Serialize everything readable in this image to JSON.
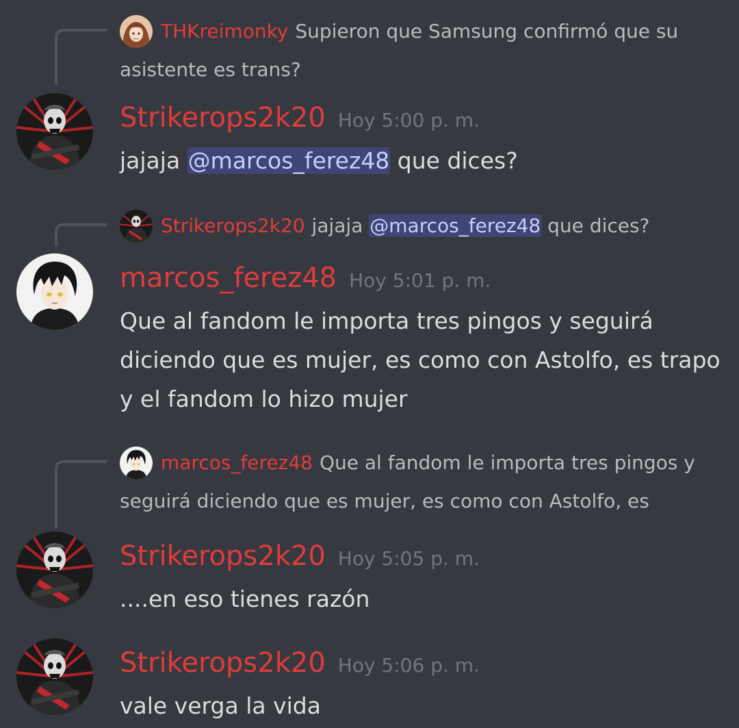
{
  "messages": [
    {
      "reply": {
        "username": "THKreimonky",
        "text": "Supieron que Samsung confirmó que su asistente es trans?"
      },
      "username": "Strikerops2k20",
      "timestamp": "Hoy 5:00 p. m.",
      "content_before": "jajaja ",
      "mention": "@marcos_ferez48",
      "content_after": " que dices?"
    },
    {
      "reply": {
        "username": "Strikerops2k20",
        "text_before": "jajaja ",
        "mention": "@marcos_ferez48",
        "text_after": " que dices?"
      },
      "username": "marcos_ferez48",
      "timestamp": "Hoy 5:01 p. m.",
      "content": "Que al fandom le importa tres pingos y seguirá diciendo que es mujer, es como con Astolfo, es trapo y el fandom lo hizo mujer"
    },
    {
      "reply": {
        "username": "marcos_ferez48",
        "text": "Que al fandom le importa tres pingos y seguirá diciendo que es mujer, es como con Astolfo, es"
      },
      "username": "Strikerops2k20",
      "timestamp": "Hoy 5:05 p. m.",
      "content": "....en eso tienes razón"
    },
    {
      "username": "Strikerops2k20",
      "timestamp": "Hoy 5:06 p. m.",
      "content": "vale verga la vida"
    }
  ]
}
